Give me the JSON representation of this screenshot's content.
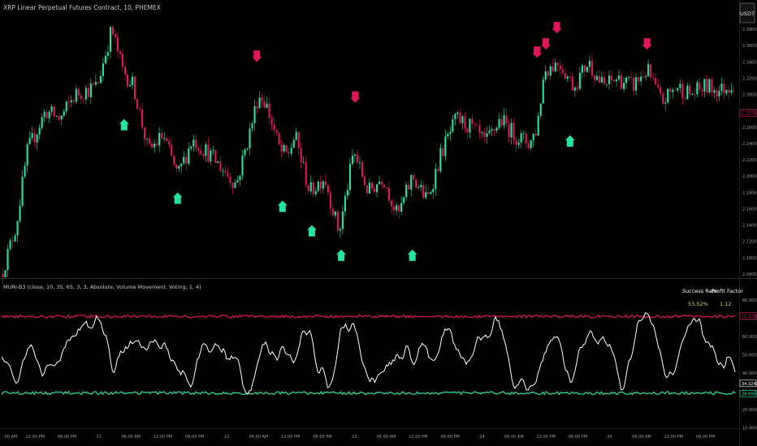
{
  "header": {
    "symbol_title": "XRP Linear Perpetual Futures Contract, 10, PHEMEX",
    "currency_button": "USDT"
  },
  "indicator": {
    "title": "MURI-B3 (close, 10, 35, 65, 3, 3, Absolute, Volume Movement, Voting, 1, 4)",
    "stats": {
      "success_rate_label": "Success Rate",
      "profit_factor_label": "Profit Factor",
      "success_rate_value": "53.52%",
      "profit_factor_value": "1.12"
    }
  },
  "price_axis": {
    "ticks": [
      "2.3800",
      "2.3600",
      "2.3400",
      "2.3200",
      "2.3000",
      "2.2800",
      "2.2600",
      "2.2400",
      "2.2200",
      "2.2000",
      "2.1800",
      "2.1600",
      "2.1400",
      "2.1200",
      "2.1000",
      "2.0800"
    ],
    "current_label": "2.2774"
  },
  "osc_axis": {
    "ticks": [
      "80.0000",
      "70.0000",
      "60.0000",
      "50.0000",
      "40.0000",
      "30.0000",
      "20.0000",
      "10.0000"
    ],
    "upper_label": "71.3248",
    "value_label": "34.3240",
    "lower_label": "28.6950"
  },
  "time_axis": {
    "labels": [
      ":00 AM",
      "12:00 PM",
      "06:00 PM",
      "21",
      "06:00 AM",
      "12:00 PM",
      "06:00 PM",
      "22",
      "06:00 AM",
      "12:00 PM",
      "06:00 PM",
      "23",
      "06:00 AM",
      "12:00 PM",
      "06:00 PM",
      "24",
      "06:00 AM",
      "12:00 PM",
      "06:00 PM",
      "25",
      "06:00 AM",
      "12:00 PM",
      "06:00 PM"
    ]
  },
  "colors": {
    "bull": "#26e4a0",
    "bear": "#e0155a",
    "upper_band": "#e0155a",
    "lower_band": "#26e4a0",
    "osc": "#ffffff",
    "success_value": "#d4d96a",
    "profit_value": "#d4d96a"
  },
  "chart_data": {
    "type": "candlestick",
    "price_keypoints": [
      [
        0.0,
        2.08
      ],
      [
        0.02,
        2.14
      ],
      [
        0.035,
        2.23
      ],
      [
        0.06,
        2.28
      ],
      [
        0.08,
        2.27
      ],
      [
        0.1,
        2.3
      ],
      [
        0.13,
        2.31
      ],
      [
        0.15,
        2.38
      ],
      [
        0.165,
        2.33
      ],
      [
        0.18,
        2.31
      ],
      [
        0.2,
        2.23
      ],
      [
        0.22,
        2.25
      ],
      [
        0.24,
        2.2
      ],
      [
        0.26,
        2.245
      ],
      [
        0.28,
        2.23
      ],
      [
        0.3,
        2.21
      ],
      [
        0.32,
        2.19
      ],
      [
        0.34,
        2.26
      ],
      [
        0.35,
        2.3
      ],
      [
        0.36,
        2.29
      ],
      [
        0.38,
        2.23
      ],
      [
        0.39,
        2.225
      ],
      [
        0.4,
        2.25
      ],
      [
        0.42,
        2.18
      ],
      [
        0.44,
        2.2
      ],
      [
        0.46,
        2.13
      ],
      [
        0.48,
        2.23
      ],
      [
        0.5,
        2.18
      ],
      [
        0.52,
        2.2
      ],
      [
        0.54,
        2.15
      ],
      [
        0.56,
        2.2
      ],
      [
        0.58,
        2.17
      ],
      [
        0.6,
        2.23
      ],
      [
        0.62,
        2.27
      ],
      [
        0.64,
        2.26
      ],
      [
        0.66,
        2.24
      ],
      [
        0.68,
        2.27
      ],
      [
        0.7,
        2.25
      ],
      [
        0.72,
        2.24
      ],
      [
        0.73,
        2.26
      ],
      [
        0.74,
        2.33
      ],
      [
        0.76,
        2.34
      ],
      [
        0.78,
        2.31
      ],
      [
        0.8,
        2.34
      ],
      [
        0.82,
        2.31
      ],
      [
        0.84,
        2.32
      ],
      [
        0.86,
        2.31
      ],
      [
        0.88,
        2.33
      ],
      [
        0.9,
        2.29
      ],
      [
        0.92,
        2.31
      ],
      [
        0.94,
        2.3
      ],
      [
        0.96,
        2.31
      ],
      [
        0.98,
        2.305
      ],
      [
        1.0,
        2.315
      ]
    ],
    "buy_signals": [
      {
        "x": 0.167,
        "price": 2.27
      },
      {
        "x": 0.24,
        "price": 2.18
      },
      {
        "x": 0.383,
        "price": 2.17
      },
      {
        "x": 0.423,
        "price": 2.14
      },
      {
        "x": 0.463,
        "price": 2.11
      },
      {
        "x": 0.56,
        "price": 2.11
      },
      {
        "x": 0.775,
        "price": 2.25
      }
    ],
    "sell_signals": [
      {
        "x": 0.348,
        "price": 2.34
      },
      {
        "x": 0.482,
        "price": 2.29
      },
      {
        "x": 0.73,
        "price": 2.345
      },
      {
        "x": 0.742,
        "price": 2.355
      },
      {
        "x": 0.757,
        "price": 2.375
      },
      {
        "x": 0.88,
        "price": 2.355
      }
    ],
    "osc_upper_band": 71,
    "osc_lower_band": 29,
    "osc_range": [
      10,
      85
    ]
  }
}
